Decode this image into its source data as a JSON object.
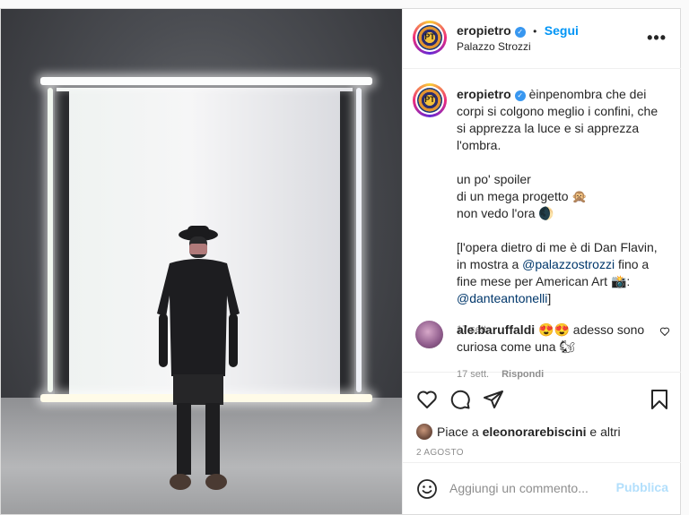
{
  "post": {
    "username": "eropietro",
    "avatar_initials": "PT",
    "follow_label": "Segui",
    "location": "Palazzo Strozzi",
    "more_label": "•••"
  },
  "caption": {
    "username": "eropietro",
    "line1": "èinpenombra che dei corpi si colgono meglio i confini, che si apprezza la luce e si apprezza l'ombra.",
    "line2": "un po' spoiler",
    "line3": "di un mega progetto 🙊",
    "line4": "non vedo l'ora 🌒",
    "line5_pre": "[l'opera dietro di me è di Dan Flavin, in mostra a ",
    "line5_link": "@palazzostrozzi",
    "line5_post": " fino a fine mese per American Art 📸:",
    "line6_link": "@danteantonelli",
    "line6_post": "]",
    "time": "17 sett."
  },
  "comment": {
    "username": "ale.baruffaldi",
    "text": "😍😍 adesso sono curiosa come una 🐿",
    "time": "17 sett.",
    "reply_label": "Rispondi"
  },
  "likes": {
    "prefix": "Piace a ",
    "user": "eleonorarebiscini",
    "suffix": " e altri"
  },
  "date": "2 AGOSTO",
  "comment_box": {
    "placeholder": "Aggiungi un commento...",
    "publish_label": "Pubblica"
  },
  "icons": [
    "emoji-icon",
    "heart-icon",
    "comment-icon",
    "share-icon",
    "bookmark-icon",
    "verified-icon",
    "small-heart-icon"
  ],
  "colors": {
    "follow": "#0095f6",
    "publish_disabled": "#b2dffc",
    "link": "#00376b",
    "muted": "#8e8e8e"
  }
}
